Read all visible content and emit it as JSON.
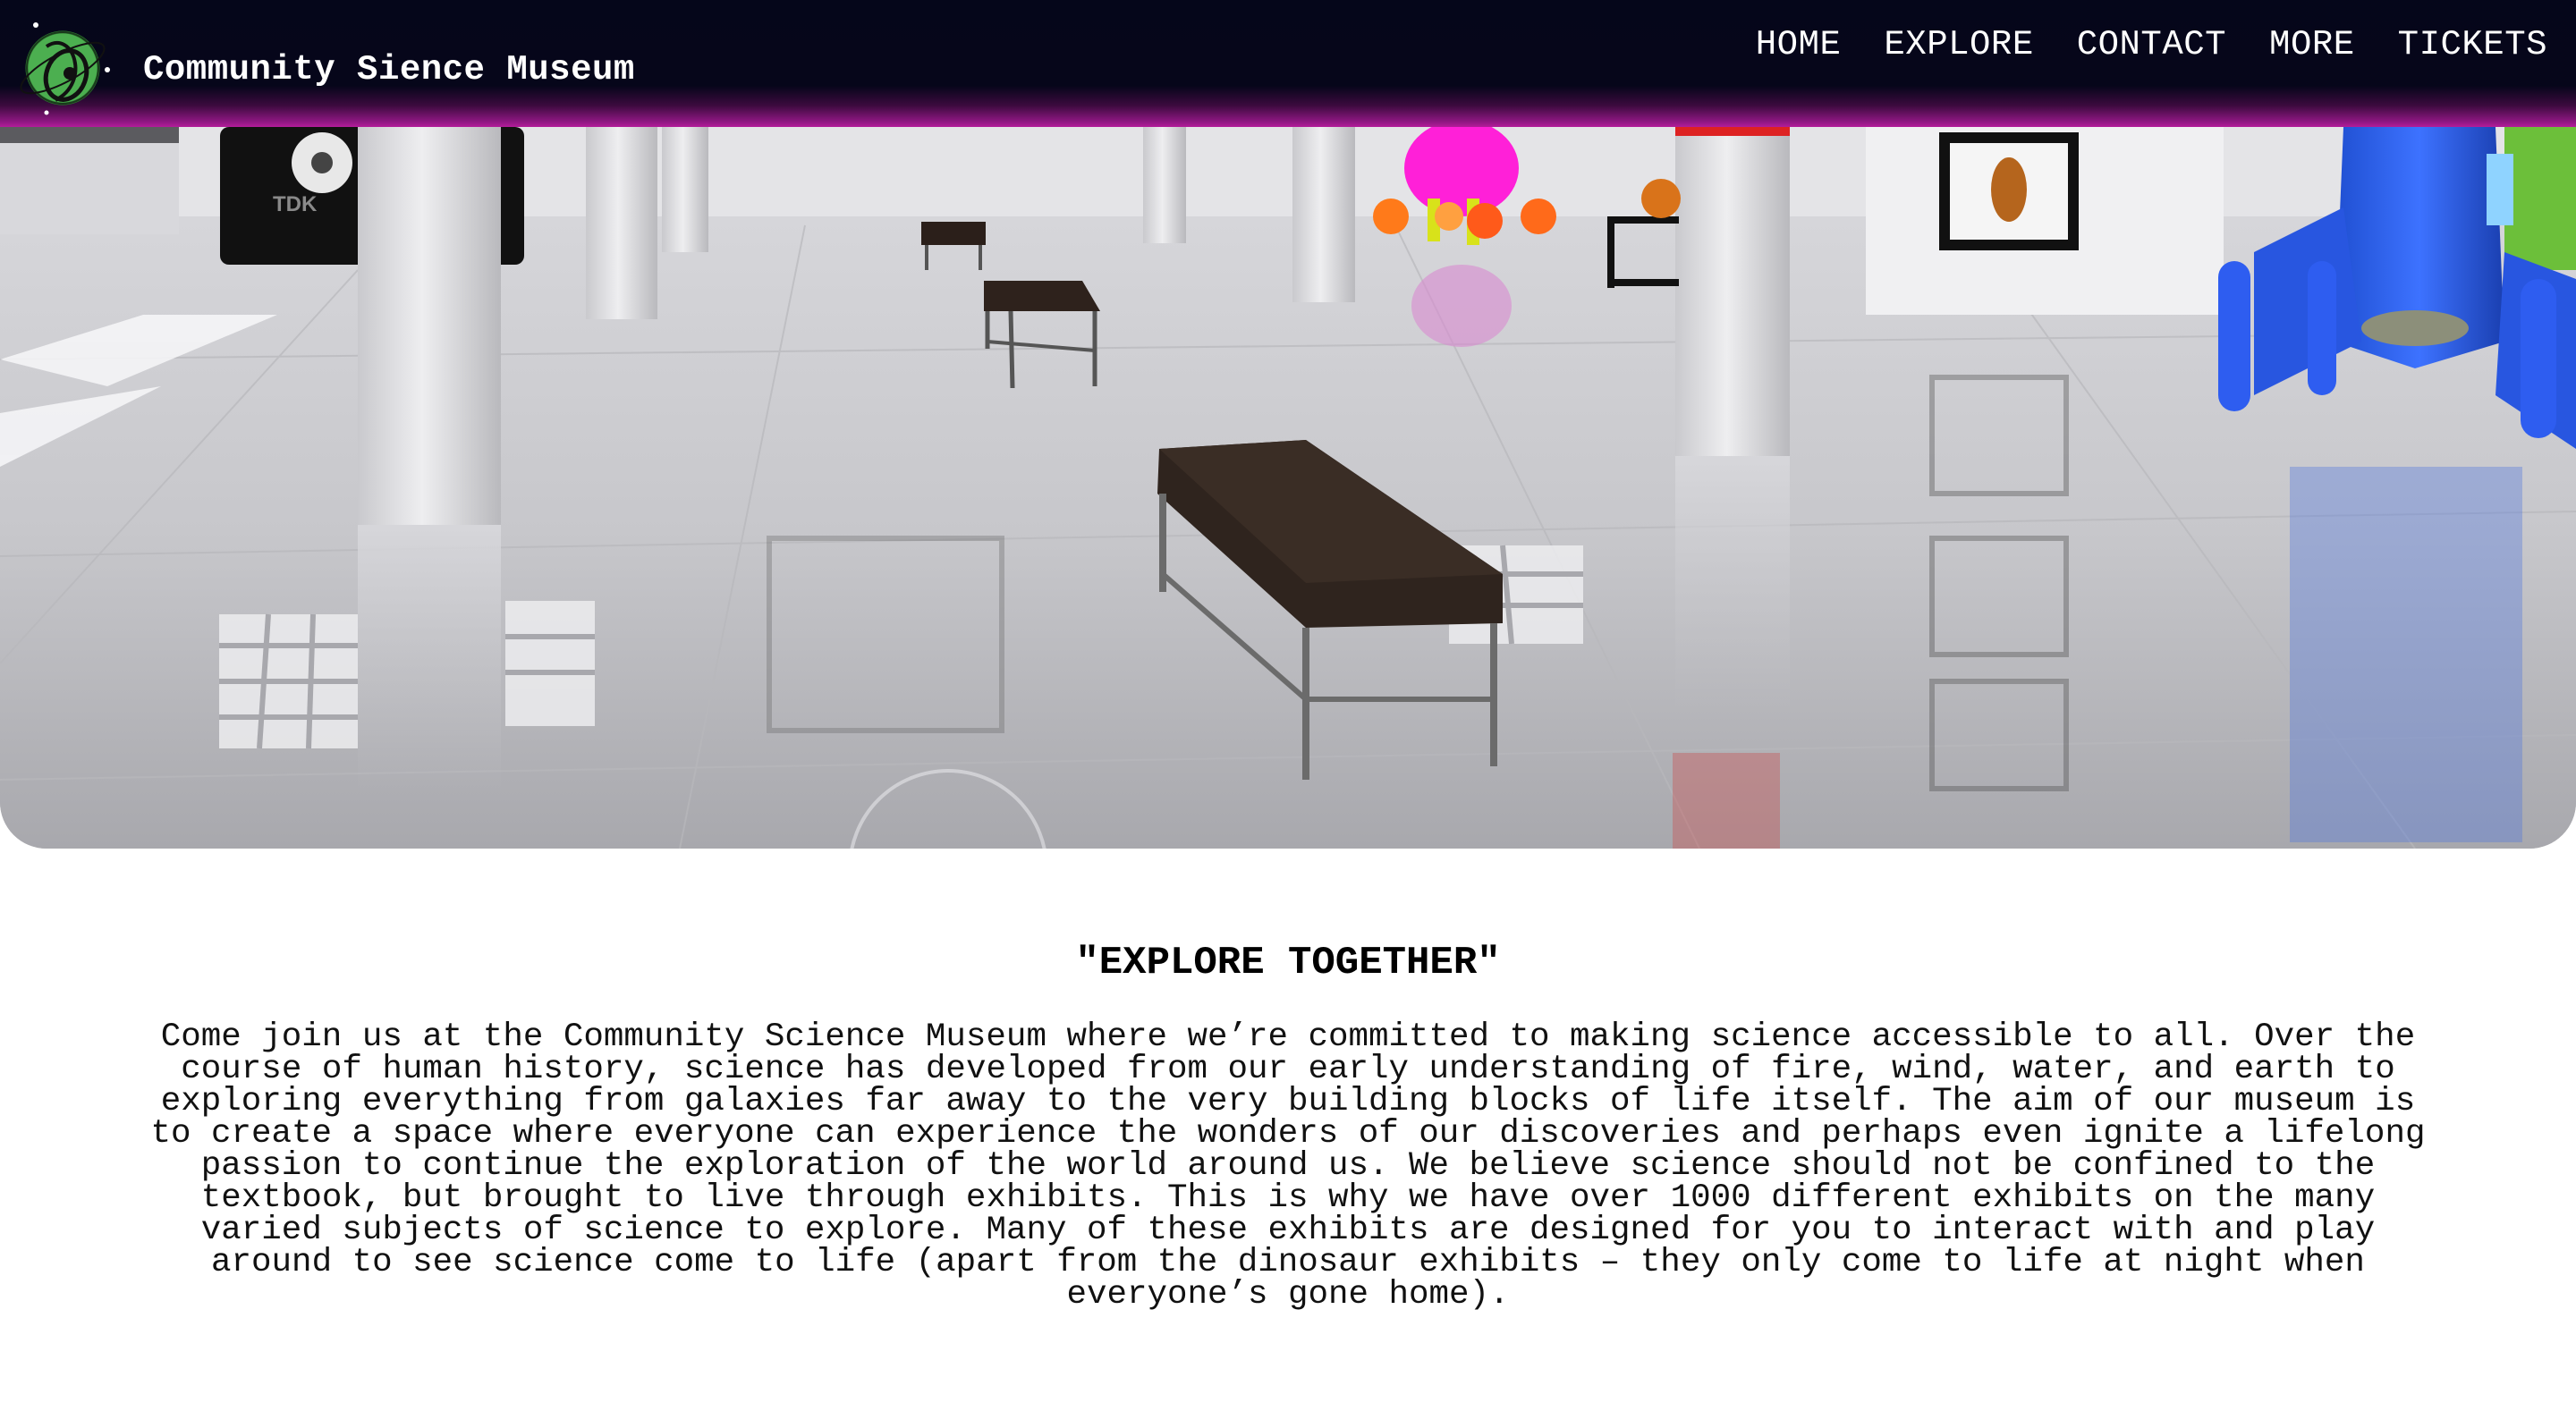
{
  "header": {
    "site_title": "Community Sience Museum",
    "nav": [
      {
        "label": "HOME"
      },
      {
        "label": "EXPLORE"
      },
      {
        "label": "CONTACT"
      },
      {
        "label": "MORE"
      },
      {
        "label": "TICKETS"
      }
    ]
  },
  "hero": {
    "cassette_brand": "TDK"
  },
  "main": {
    "heading": "\"EXPLORE TOGETHER\"",
    "intro": "Come join us at the Community Science Museum where we’re committed to making science accessible to all. Over the course of human history, science has developed from our early understanding of fire, wind, water, and earth to exploring everything from galaxies far away to the very building blocks of life itself. The aim of our museum is to create a space where everyone can experience the wonders of our discoveries and perhaps even ignite a lifelong passion to continue the exploration of the world around us. We believe science should not be confined to the textbook, but brought to live through exhibits. This is why we have over 1000 different exhibits on the many varied subjects of science to explore. Many of these exhibits are designed for you to interact with and play around to see science come to life (apart from the dinosaur exhibits – they only come to life at night when everyone’s gone home)."
  },
  "colors": {
    "header_bg": "#05061a",
    "header_glow": "#b31c9a",
    "logo_green": "#4caf50",
    "title_text": "#ffffff"
  }
}
